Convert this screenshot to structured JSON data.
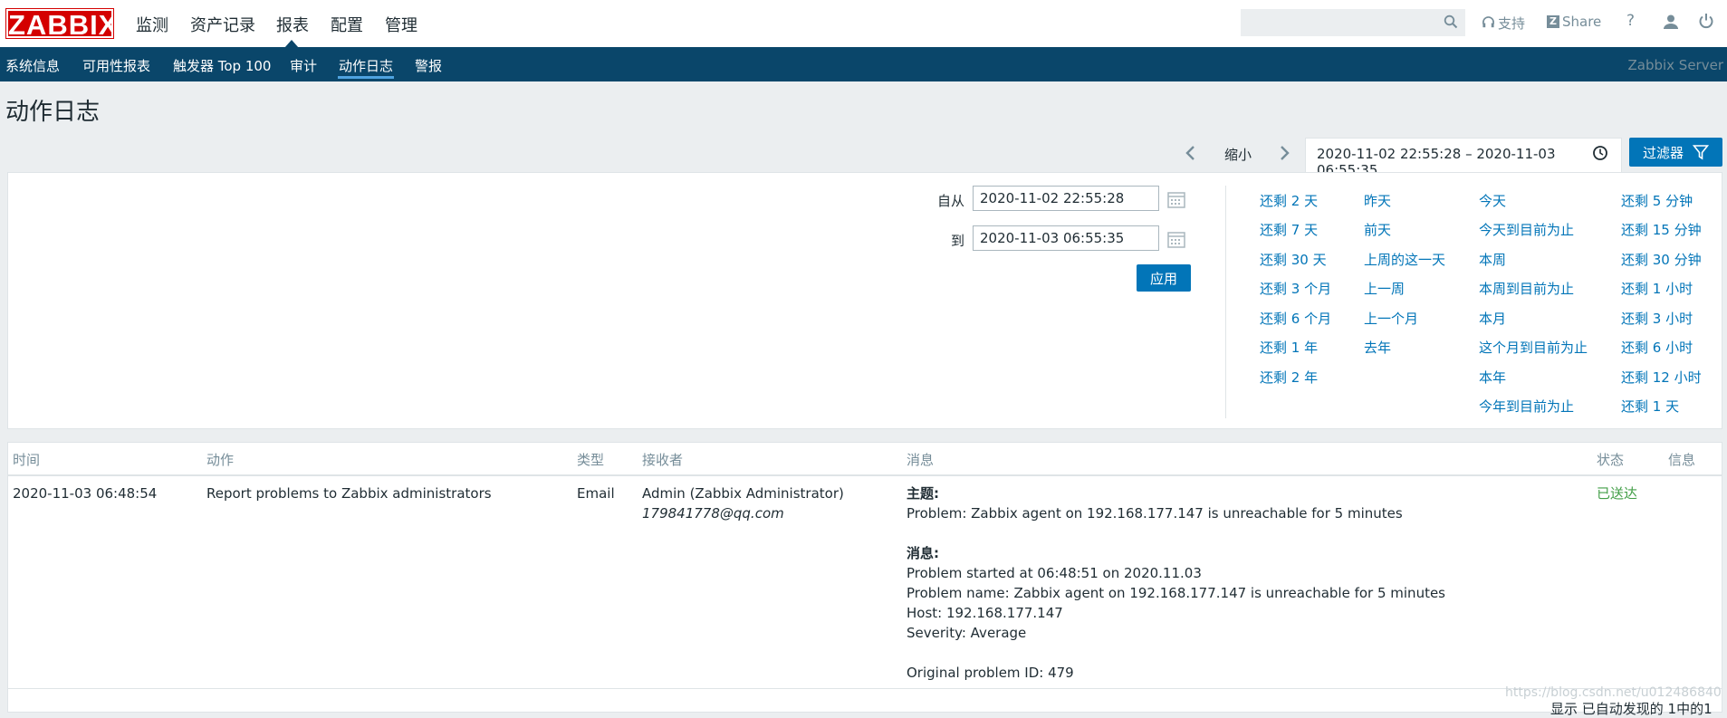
{
  "header": {
    "logo": "ZABBIX",
    "menu": [
      "监测",
      "资产记录",
      "报表",
      "配置",
      "管理"
    ],
    "active_menu": "报表",
    "search_placeholder": "",
    "support_label": "支持",
    "share_label": "Share",
    "help_label": "?"
  },
  "subnav": {
    "items": [
      "系统信息",
      "可用性报表",
      "触发器 Top 100",
      "审计",
      "动作日志",
      "警报"
    ],
    "active": "动作日志",
    "server_name": "Zabbix Server"
  },
  "page": {
    "title": "动作日志"
  },
  "timebar": {
    "zoom_label": "缩小",
    "range": "2020-11-02 22:55:28 – 2020-11-03 06:55:35",
    "filter_label": "过滤器"
  },
  "filter": {
    "from_label": "自从",
    "from_value": "2020-11-02 22:55:28",
    "to_label": "到",
    "to_value": "2020-11-03 06:55:35",
    "apply_label": "应用",
    "quick_cols": [
      [
        "还剩 2 天",
        "还剩 7 天",
        "还剩 30 天",
        "还剩 3 个月",
        "还剩 6 个月",
        "还剩 1 年",
        "还剩 2 年"
      ],
      [
        "昨天",
        "前天",
        "上周的这一天",
        "上一周",
        "上一个月",
        "去年"
      ],
      [
        "今天",
        "今天到目前为止",
        "本周",
        "本周到目前为止",
        "本月",
        "这个月到目前为止",
        "本年",
        "今年到目前为止"
      ],
      [
        "还剩 5 分钟",
        "还剩 15 分钟",
        "还剩 30 分钟",
        "还剩 1 小时",
        "还剩 3 小时",
        "还剩 6 小时",
        "还剩 12 小时",
        "还剩 1 天"
      ]
    ]
  },
  "table": {
    "headers": [
      "时间",
      "动作",
      "类型",
      "接收者",
      "消息",
      "状态",
      "信息"
    ],
    "rows": [
      {
        "time": "2020-11-03 06:48:54",
        "action": "Report problems to Zabbix administrators",
        "type": "Email",
        "recipient_name": "Admin (Zabbix Administrator)",
        "recipient_email": "179841778@qq.com",
        "subject_label": "主题:",
        "subject": "Problem: Zabbix agent on 192.168.177.147 is unreachable for 5 minutes",
        "message_label": "消息:",
        "message_lines": [
          "Problem started at 06:48:51 on 2020.11.03",
          "Problem name: Zabbix agent on 192.168.177.147 is unreachable for 5 minutes",
          "Host: 192.168.177.147",
          "Severity: Average"
        ],
        "original_problem": "Original problem ID: 479",
        "status": "已送达",
        "info": ""
      }
    ],
    "footer": "显示 已自动发现的 1中的1"
  },
  "watermark": "https://blog.csdn.net/u012486840",
  "colors": {
    "brand_red": "#d40000",
    "nav_blue": "#0a466a",
    "link_blue": "#0275b8",
    "status_green": "#429e47"
  }
}
